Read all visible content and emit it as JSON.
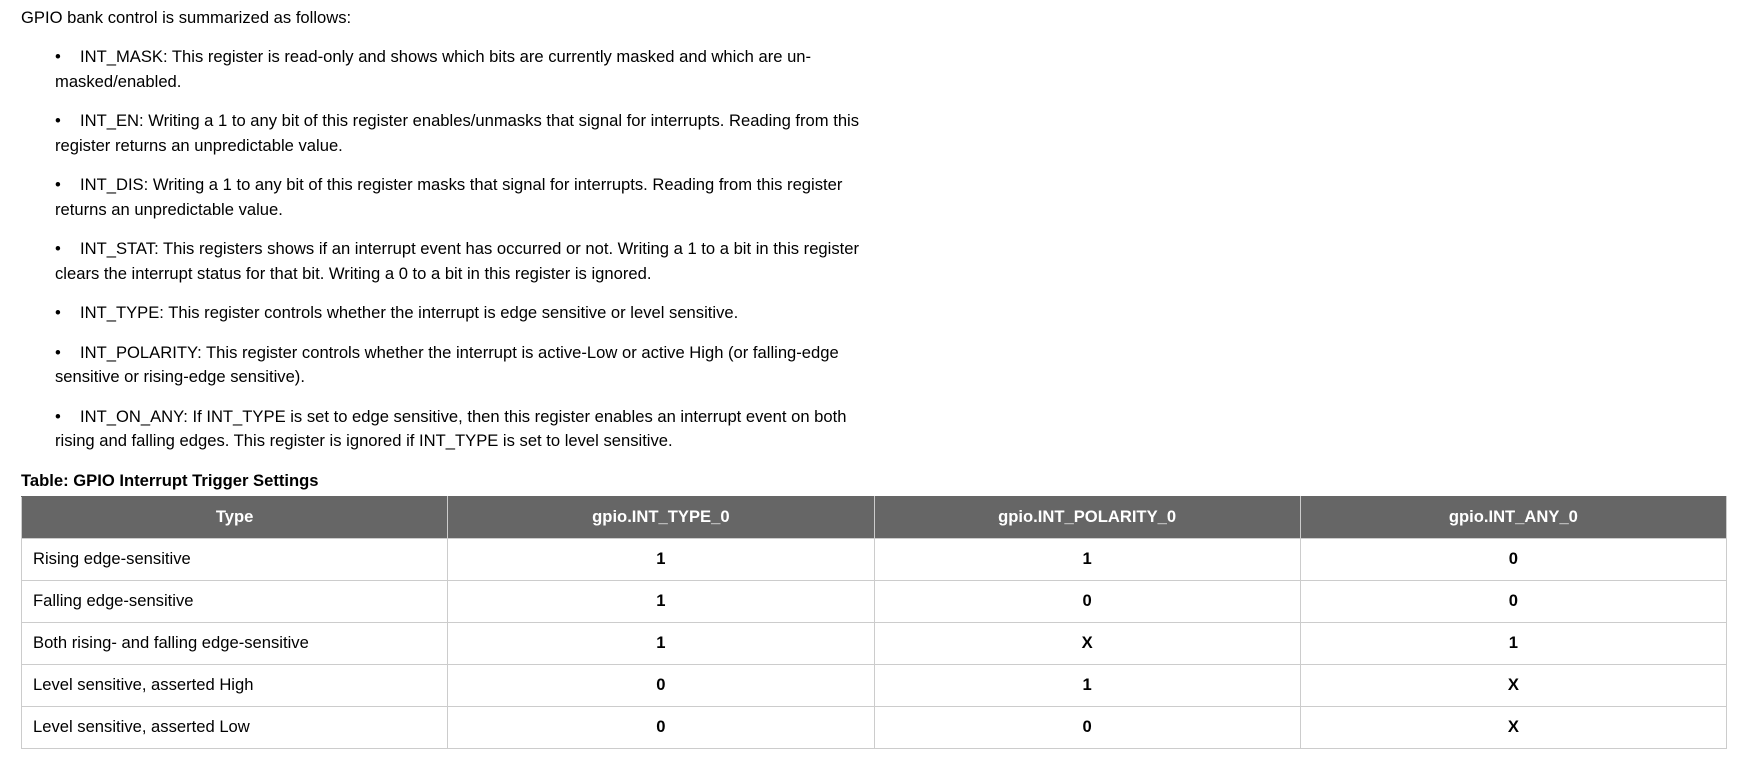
{
  "intro": "GPIO bank control is summarized as follows:",
  "bullet_symbol": "•",
  "bullets": [
    {
      "line1": "INT_MASK: This register is read-only and shows which bits are currently masked and which are un-",
      "line2": "masked/enabled."
    },
    {
      "line1": "INT_EN: Writing a 1 to any bit of this register enables/unmasks that signal for interrupts. Reading from this",
      "line2": "register returns an unpredictable value."
    },
    {
      "line1": "INT_DIS: Writing a 1 to any bit of this register masks that signal for interrupts. Reading from this register",
      "line2": "returns an unpredictable value."
    },
    {
      "line1": "INT_STAT: This registers shows if an interrupt event has occurred or not. Writing a 1 to a bit in this register",
      "line2": "clears the interrupt status for that bit. Writing a 0 to a bit in this register is ignored."
    },
    {
      "line1": "INT_TYPE: This register controls whether the interrupt is edge sensitive or level sensitive.",
      "line2": ""
    },
    {
      "line1": "INT_POLARITY: This register controls whether the interrupt is active-Low or active High (or falling-edge",
      "line2": "sensitive or rising-edge sensitive)."
    },
    {
      "line1": "INT_ON_ANY: If INT_TYPE is set to edge sensitive, then this register enables an interrupt event on both",
      "line2": "rising and falling edges. This register is ignored if INT_TYPE is set to level sensitive."
    }
  ],
  "table": {
    "caption": "Table: GPIO Interrupt Trigger Settings",
    "headers": [
      "Type",
      "gpio.INT_TYPE_0",
      "gpio.INT_POLARITY_0",
      "gpio.INT_ANY_0"
    ],
    "rows": [
      [
        "Rising edge-sensitive",
        "1",
        "1",
        "0"
      ],
      [
        "Falling edge-sensitive",
        "1",
        "0",
        "0"
      ],
      [
        "Both rising- and falling edge-sensitive",
        "1",
        "X",
        "1"
      ],
      [
        "Level sensitive, asserted High",
        "0",
        "1",
        "X"
      ],
      [
        "Level sensitive, asserted Low",
        "0",
        "0",
        "X"
      ]
    ],
    "header_bg": "#666666",
    "header_text": "#ffffff",
    "border": "#cccccc"
  }
}
